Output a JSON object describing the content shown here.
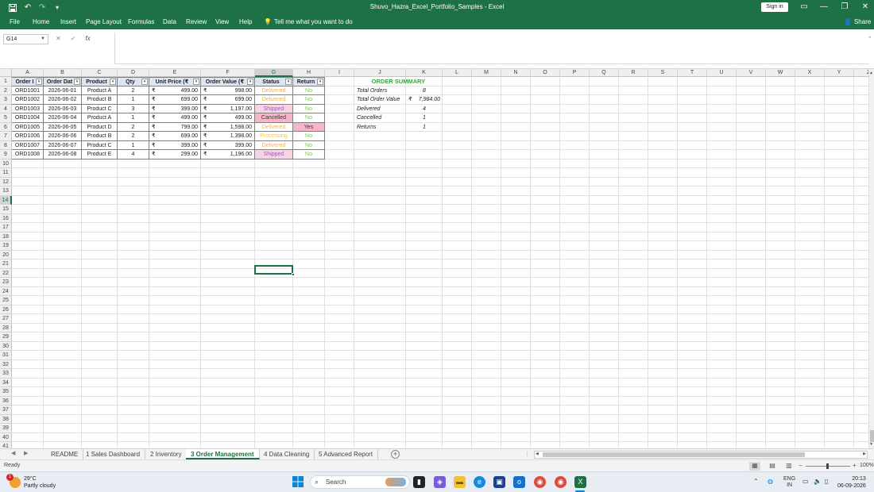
{
  "window": {
    "title": "Shuvo_Hazra_Excel_Portfolio_Samples  -  Excel",
    "signin": "Sign in",
    "ribbon_tabs": [
      "File",
      "Home",
      "Insert",
      "Page Layout",
      "Formulas",
      "Data",
      "Review",
      "View",
      "Help"
    ],
    "tell_me": "Tell me what you want to do",
    "share": "Share"
  },
  "formula_bar": {
    "name_box": "G14",
    "formula": ""
  },
  "columns": [
    "A",
    "B",
    "C",
    "D",
    "E",
    "F",
    "G",
    "H",
    "I",
    "J",
    "K",
    "L",
    "M",
    "N",
    "O",
    "P",
    "Q",
    "R",
    "S",
    "T",
    "U",
    "V",
    "W",
    "X",
    "Y",
    "Z"
  ],
  "rows": [
    "1",
    "2",
    "3",
    "4",
    "5",
    "6",
    "7",
    "8",
    "9",
    "10",
    "11",
    "12",
    "13",
    "14",
    "15",
    "16",
    "17",
    "18",
    "19",
    "20",
    "21",
    "22",
    "23",
    "24",
    "25",
    "26",
    "27",
    "28",
    "29",
    "30",
    "31",
    "32",
    "33",
    "34",
    "35",
    "36",
    "37",
    "38",
    "39",
    "40",
    "41"
  ],
  "orders": {
    "headers": [
      "Order I",
      "Order Dat",
      "Product",
      "Qty",
      "Unit Price (₹",
      "Order Value (₹",
      "Status",
      "Return"
    ],
    "currency": "₹",
    "rows": [
      {
        "id": "ORD1001",
        "date": "2026-06-01",
        "product": "Product A",
        "qty": "2",
        "unit": "499.00",
        "value": "998.00",
        "status": "Delivered",
        "return": "No"
      },
      {
        "id": "ORD1002",
        "date": "2026-06-02",
        "product": "Product B",
        "qty": "1",
        "unit": "699.00",
        "value": "699.00",
        "status": "Delivered",
        "return": "No"
      },
      {
        "id": "ORD1003",
        "date": "2026-06-03",
        "product": "Product C",
        "qty": "3",
        "unit": "399.00",
        "value": "1,197.00",
        "status": "Shipped",
        "return": "No"
      },
      {
        "id": "ORD1004",
        "date": "2026-06-04",
        "product": "Product A",
        "qty": "1",
        "unit": "499.00",
        "value": "499.00",
        "status": "Cancelled",
        "return": "No"
      },
      {
        "id": "ORD1005",
        "date": "2026-06-05",
        "product": "Product D",
        "qty": "2",
        "unit": "799.00",
        "value": "1,598.00",
        "status": "Delivered",
        "return": "Yes"
      },
      {
        "id": "ORD1006",
        "date": "2026-06-06",
        "product": "Product B",
        "qty": "2",
        "unit": "699.00",
        "value": "1,398.00",
        "status": "Processing",
        "return": "No"
      },
      {
        "id": "ORD1007",
        "date": "2026-06-07",
        "product": "Product C",
        "qty": "1",
        "unit": "399.00",
        "value": "399.00",
        "status": "Delivered",
        "return": "No"
      },
      {
        "id": "ORD1008",
        "date": "2026-06-08",
        "product": "Product E",
        "qty": "4",
        "unit": "299.00",
        "value": "1,196.00",
        "status": "Shipped",
        "return": "No"
      }
    ]
  },
  "status_styles": {
    "Delivered": {
      "bg": "#ffffff",
      "fg": "#f2b24e"
    },
    "Shipped": {
      "bg": "#f9d3e4",
      "fg": "#9a5fb8"
    },
    "Cancelled": {
      "bg": "#f4b6c8",
      "fg": "#3a3a3a"
    },
    "Processing": {
      "bg": "#ffffff",
      "fg": "#f6c54a"
    }
  },
  "return_styles": {
    "No": {
      "bg": "#ffffff",
      "fg": "#7ac24e"
    },
    "Yes": {
      "bg": "#f4b6c8",
      "fg": "#3a3a3a"
    }
  },
  "summary": {
    "title": "ORDER SUMMARY",
    "title_color": "#43a047",
    "rows": [
      {
        "label": "Total Orders",
        "prefix": "",
        "value": "8"
      },
      {
        "label": "Total Order Value",
        "prefix": "₹",
        "value": "7,984.00"
      },
      {
        "label": "Delivered",
        "prefix": "",
        "value": "4"
      },
      {
        "label": "Cancelled",
        "prefix": "",
        "value": "1"
      },
      {
        "label": "Returns",
        "prefix": "",
        "value": "1"
      }
    ]
  },
  "sheets": {
    "tabs": [
      "README",
      "1 Sales Dashboard",
      "2 Inventory",
      "3 Order Management",
      "4 Data Cleaning",
      "5 Advanced Report"
    ],
    "active": "3 Order Management"
  },
  "statusbar": {
    "ready": "Ready",
    "zoom": "100%"
  },
  "taskbar": {
    "weather_temp": "29°C",
    "weather_desc": "Partly cloudy",
    "weather_badge": "1",
    "search": "Search",
    "lang": "ENG",
    "region": "IN",
    "time": "20:13",
    "date": "06-09-2026"
  },
  "colors": {
    "excel_green": "#1e7145",
    "table_header": "#dce6f1"
  }
}
